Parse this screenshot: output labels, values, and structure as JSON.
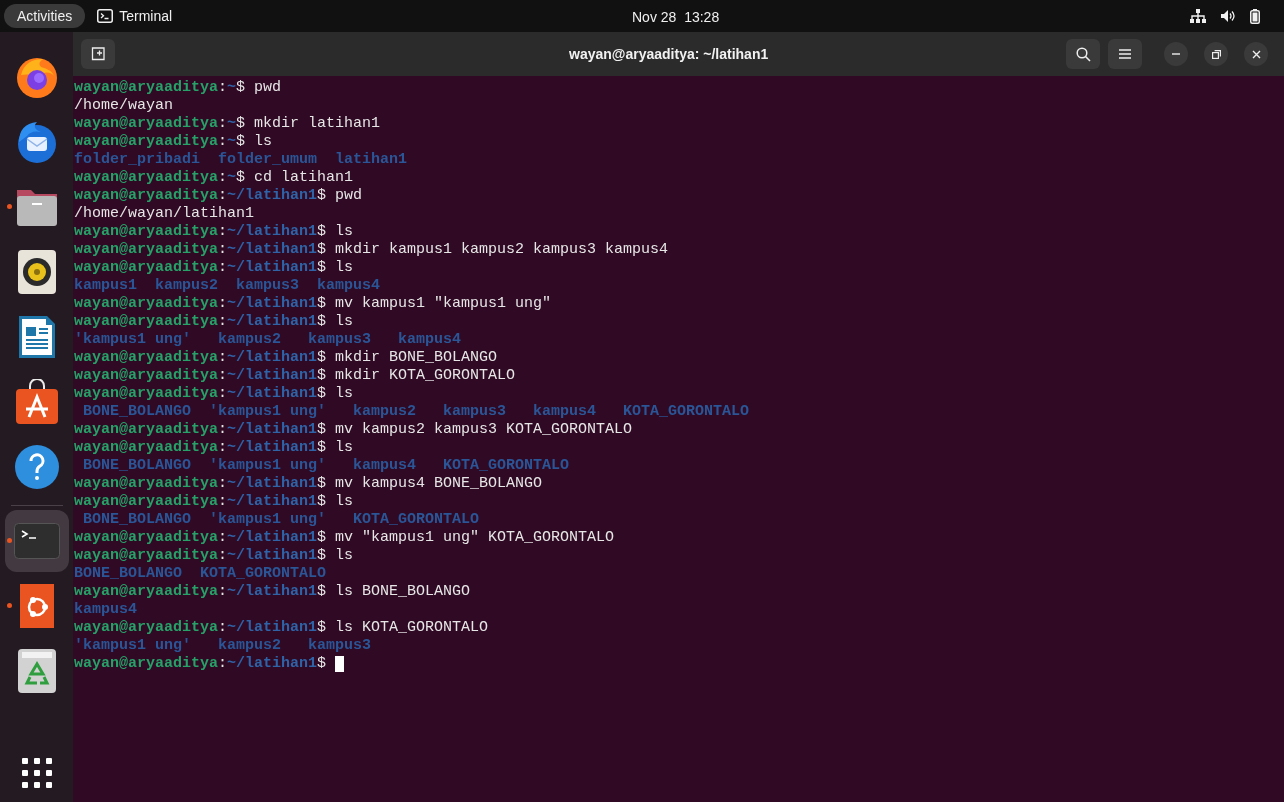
{
  "top_bar": {
    "activities": "Activities",
    "app_name": "Terminal",
    "clock": "Nov 28  13:28"
  },
  "dock": {
    "items": [
      {
        "kind": "browser",
        "running": false,
        "selected": false
      },
      {
        "kind": "mail",
        "running": false,
        "selected": false
      },
      {
        "kind": "files",
        "running": true,
        "selected": false
      },
      {
        "kind": "speaker",
        "running": false,
        "selected": false
      },
      {
        "kind": "document",
        "running": false,
        "selected": false
      },
      {
        "kind": "store",
        "running": false,
        "selected": false
      },
      {
        "kind": "help",
        "running": false,
        "selected": false
      },
      {
        "kind": "terminal",
        "running": true,
        "selected": true
      },
      {
        "kind": "ubuntu",
        "running": true,
        "selected": false
      },
      {
        "kind": "trash",
        "running": false,
        "selected": false
      }
    ]
  },
  "window": {
    "title": "wayan@aryaaditya: ~/latihan1"
  },
  "terminal": {
    "lines": [
      {
        "kind": "prompt",
        "user": "wayan@aryaaditya",
        "separator": ":",
        "path": "~",
        "command": "$ pwd"
      },
      {
        "kind": "output",
        "text": "/home/wayan"
      },
      {
        "kind": "prompt",
        "user": "wayan@aryaaditya",
        "separator": ":",
        "path": "~",
        "command": "$ mkdir latihan1"
      },
      {
        "kind": "prompt",
        "user": "wayan@aryaaditya",
        "separator": ":",
        "path": "~",
        "command": "$ ls"
      },
      {
        "kind": "listing",
        "text": "folder_pribadi  folder_umum  latihan1"
      },
      {
        "kind": "prompt",
        "user": "wayan@aryaaditya",
        "separator": ":",
        "path": "~",
        "command": "$ cd latihan1"
      },
      {
        "kind": "prompt",
        "user": "wayan@aryaaditya",
        "separator": ":",
        "path": "~/latihan1",
        "command": "$ pwd"
      },
      {
        "kind": "output",
        "text": "/home/wayan/latihan1"
      },
      {
        "kind": "prompt",
        "user": "wayan@aryaaditya",
        "separator": ":",
        "path": "~/latihan1",
        "command": "$ ls"
      },
      {
        "kind": "prompt",
        "user": "wayan@aryaaditya",
        "separator": ":",
        "path": "~/latihan1",
        "command": "$ mkdir kampus1 kampus2 kampus3 kampus4"
      },
      {
        "kind": "prompt",
        "user": "wayan@aryaaditya",
        "separator": ":",
        "path": "~/latihan1",
        "command": "$ ls"
      },
      {
        "kind": "listing",
        "text": "kampus1  kampus2  kampus3  kampus4"
      },
      {
        "kind": "prompt",
        "user": "wayan@aryaaditya",
        "separator": ":",
        "path": "~/latihan1",
        "command": "$ mv kampus1 \"kampus1 ung\""
      },
      {
        "kind": "prompt",
        "user": "wayan@aryaaditya",
        "separator": ":",
        "path": "~/latihan1",
        "command": "$ ls"
      },
      {
        "kind": "listing",
        "text": "'kampus1 ung'   kampus2   kampus3   kampus4"
      },
      {
        "kind": "prompt",
        "user": "wayan@aryaaditya",
        "separator": ":",
        "path": "~/latihan1",
        "command": "$ mkdir BONE_BOLANGO"
      },
      {
        "kind": "prompt",
        "user": "wayan@aryaaditya",
        "separator": ":",
        "path": "~/latihan1",
        "command": "$ mkdir KOTA_GORONTALO"
      },
      {
        "kind": "prompt",
        "user": "wayan@aryaaditya",
        "separator": ":",
        "path": "~/latihan1",
        "command": "$ ls"
      },
      {
        "kind": "listing",
        "text": " BONE_BOLANGO  'kampus1 ung'   kampus2   kampus3   kampus4   KOTA_GORONTALO"
      },
      {
        "kind": "prompt",
        "user": "wayan@aryaaditya",
        "separator": ":",
        "path": "~/latihan1",
        "command": "$ mv kampus2 kampus3 KOTA_GORONTALO"
      },
      {
        "kind": "prompt",
        "user": "wayan@aryaaditya",
        "separator": ":",
        "path": "~/latihan1",
        "command": "$ ls"
      },
      {
        "kind": "listing",
        "text": " BONE_BOLANGO  'kampus1 ung'   kampus4   KOTA_GORONTALO"
      },
      {
        "kind": "prompt",
        "user": "wayan@aryaaditya",
        "separator": ":",
        "path": "~/latihan1",
        "command": "$ mv kampus4 BONE_BOLANGO"
      },
      {
        "kind": "prompt",
        "user": "wayan@aryaaditya",
        "separator": ":",
        "path": "~/latihan1",
        "command": "$ ls"
      },
      {
        "kind": "listing",
        "text": " BONE_BOLANGO  'kampus1 ung'   KOTA_GORONTALO"
      },
      {
        "kind": "prompt",
        "user": "wayan@aryaaditya",
        "separator": ":",
        "path": "~/latihan1",
        "command": "$ mv \"kampus1 ung\" KOTA_GORONTALO"
      },
      {
        "kind": "prompt",
        "user": "wayan@aryaaditya",
        "separator": ":",
        "path": "~/latihan1",
        "command": "$ ls"
      },
      {
        "kind": "listing",
        "text": "BONE_BOLANGO  KOTA_GORONTALO"
      },
      {
        "kind": "prompt",
        "user": "wayan@aryaaditya",
        "separator": ":",
        "path": "~/latihan1",
        "command": "$ ls BONE_BOLANGO"
      },
      {
        "kind": "listing",
        "text": "kampus4"
      },
      {
        "kind": "prompt",
        "user": "wayan@aryaaditya",
        "separator": ":",
        "path": "~/latihan1",
        "command": "$ ls KOTA_GORONTALO"
      },
      {
        "kind": "listing",
        "text": "'kampus1 ung'   kampus2   kampus3"
      },
      {
        "kind": "prompt",
        "user": "wayan@aryaaditya",
        "separator": ":",
        "path": "~/latihan1",
        "command": "$ ",
        "cursor": true
      }
    ]
  }
}
